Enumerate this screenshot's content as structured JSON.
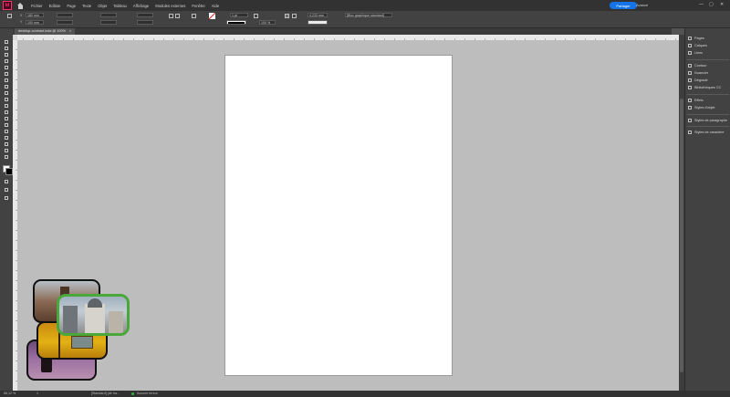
{
  "app": {
    "logo_text": "Id"
  },
  "menu": [
    "Fichier",
    "Edition",
    "Page",
    "Texte",
    "Objet",
    "Tableau",
    "Affichage",
    "Modules externes",
    "Fenêtre",
    "Aide"
  ],
  "header": {
    "share_label": "Partager",
    "workspace_label": "Avancé"
  },
  "window_controls": {
    "minimize": "—",
    "maximize": "▢",
    "close": "✕"
  },
  "control": {
    "x_label": "X",
    "x_value": "180 mm",
    "y_label": "Y",
    "y_value": "100 mm",
    "stroke_weight": "1 pt",
    "zoom": "100 %",
    "offset": "4,233 mm",
    "object_style": "[Bloc graphique standard]"
  },
  "document": {
    "tab_title": "desktop-contrast.indd @ 100%",
    "tab_close": "×"
  },
  "panels": {
    "items": [
      {
        "label": "Pages",
        "group": 1
      },
      {
        "label": "Calques",
        "group": 1
      },
      {
        "label": "Liens",
        "group": 1
      },
      {
        "label": "Contour",
        "group": 2
      },
      {
        "label": "Nuancier",
        "group": 2
      },
      {
        "label": "Dégradé",
        "group": 2
      },
      {
        "label": "Bibliothèques CC",
        "group": 2
      },
      {
        "label": "Effets",
        "group": 3
      },
      {
        "label": "Styles d'objet",
        "group": 3
      },
      {
        "label": "Styles de paragraphe",
        "group": 4
      },
      {
        "label": "Styles de caractère",
        "group": 5
      }
    ]
  },
  "status": {
    "zoom": "66,12 %",
    "page": "1",
    "master": "[Standard] (de tra...",
    "preflight": "Aucune erreur"
  },
  "colors": {
    "accent": "#1473e6",
    "logo": "#ff3366",
    "highlight": "#4aa83a"
  }
}
